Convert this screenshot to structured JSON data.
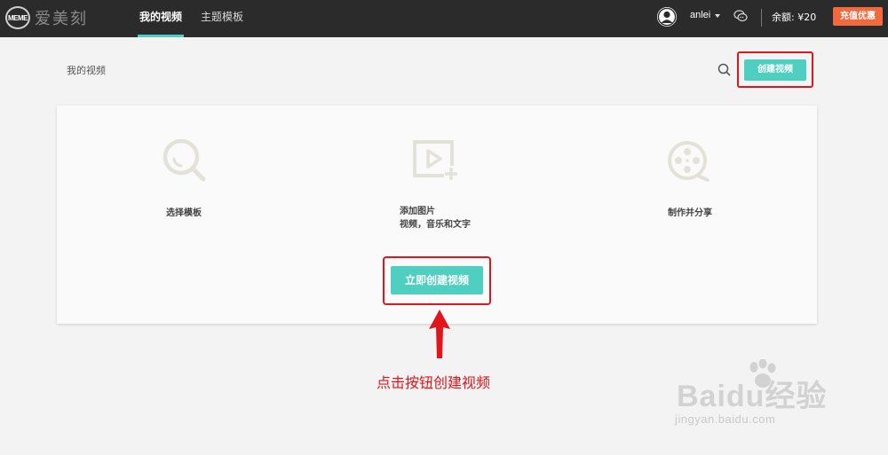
{
  "brand": {
    "logo_mark": "MEME",
    "name": "爱美刻"
  },
  "nav": {
    "tabs": [
      {
        "label": "我的视频"
      },
      {
        "label": "主题模板"
      }
    ]
  },
  "user": {
    "name": "anlei"
  },
  "account": {
    "balance": "余额: ¥20",
    "recharge_label": "充值优惠"
  },
  "header": {
    "title": "我的视频",
    "create_label": "创建视频"
  },
  "steps": [
    {
      "label": "选择模板",
      "icon": "search-icon"
    },
    {
      "label_line1": "添加图片",
      "label_line2": "视频，音乐和文字",
      "icon": "add-video-icon"
    },
    {
      "label": "制作并分享",
      "icon": "film-reel-icon"
    }
  ],
  "cta": {
    "label": "立即创建视频"
  },
  "annotation": {
    "text": "点击按钮创建视频"
  },
  "watermark": {
    "main": "Baidu经验",
    "sub": "jingyan.baidu.com"
  },
  "colors": {
    "accent": "#4ecfbf",
    "highlight": "#e1151b",
    "recharge": "#f06a3e",
    "topbar": "#2b2b2b"
  }
}
